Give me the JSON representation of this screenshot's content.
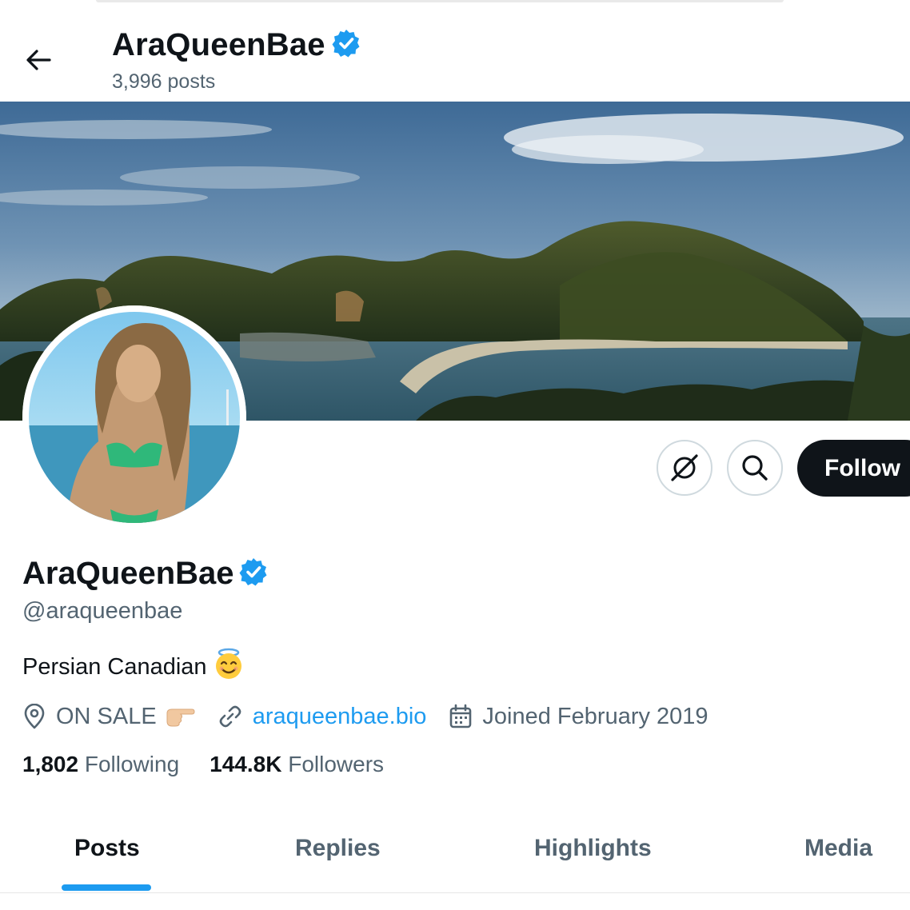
{
  "header": {
    "name": "AraQueenBae",
    "posts_count": "3,996 posts"
  },
  "profile": {
    "display_name": "AraQueenBae",
    "handle": "@araqueenbae",
    "bio": "Persian Canadian",
    "bio_emoji": "smiling-face-with-halo",
    "location": "ON SALE",
    "location_emoji": "backhand-index-pointing-right",
    "website": "araqueenbae.bio",
    "joined": "Joined February 2019",
    "following_count": "1,802",
    "following_label": "Following",
    "followers_count": "144.8K",
    "followers_label": "Followers"
  },
  "actions": {
    "follow_label": "Follow",
    "icons": [
      "grok-icon",
      "search-icon"
    ]
  },
  "tabs": [
    {
      "label": "Posts",
      "active": true
    },
    {
      "label": "Replies",
      "active": false
    },
    {
      "label": "Highlights",
      "active": false
    },
    {
      "label": "Media",
      "active": false
    }
  ],
  "colors": {
    "accent": "#1d9bf0",
    "text": "#0f1419",
    "muted": "#536471",
    "follow_bg": "#0f1419"
  }
}
